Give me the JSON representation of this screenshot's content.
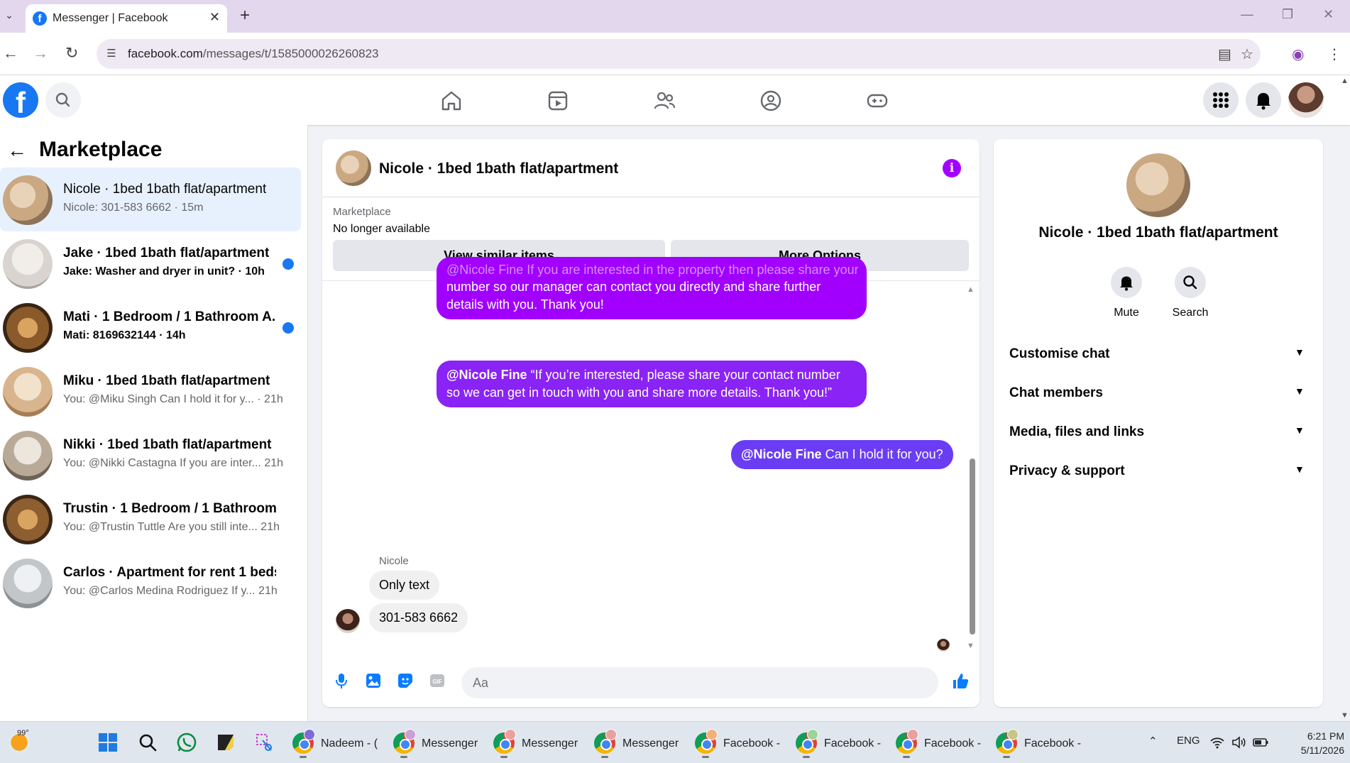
{
  "browser": {
    "tab_title": "Messenger | Facebook",
    "url_host": "facebook.com",
    "url_path": "/messages/t/1585000026260823"
  },
  "sidebar": {
    "title": "Marketplace",
    "conversations": [
      {
        "name": "Nicole · 1bed 1bath flat/apartment",
        "preview": "Nicole: 301-583 6662 · 15m",
        "unread": false,
        "active": true,
        "avatar_color": "#c9a882"
      },
      {
        "name": "Jake · 1bed 1bath flat/apartment",
        "preview": "Jake: Washer and dryer in unit? · 10h",
        "unread": true,
        "active": false,
        "avatar_color": "#d9d4cf"
      },
      {
        "name": "Mati · 1 Bedroom / 1 Bathroom A...",
        "preview": "Mati: 8169632144 · 14h",
        "unread": true,
        "active": false,
        "avatar_color": "#8a5a2b"
      },
      {
        "name": "Miku · 1bed 1bath flat/apartment",
        "preview": "You: @Miku Singh Can I hold it for y... · 21h",
        "unread": false,
        "active": false,
        "avatar_color": "#d8b58e"
      },
      {
        "name": "Nikki · 1bed 1bath flat/apartment",
        "preview": "You: @Nikki Castagna If you are inter... 21h",
        "unread": false,
        "active": false,
        "avatar_color": "#b9aa98"
      },
      {
        "name": "Trustin · 1 Bedroom / 1 Bathroom ...",
        "preview": "You: @Trustin Tuttle Are you still inte... 21h",
        "unread": false,
        "active": false,
        "avatar_color": "#8c5e30"
      },
      {
        "name": "Carlos · Apartment for rent 1 beds ...",
        "preview": "You: @Carlos Medina Rodriguez If y... 21h",
        "unread": false,
        "active": false,
        "avatar_color": "#c3c6c8"
      }
    ]
  },
  "chat": {
    "title": "Nicole · 1bed 1bath flat/apartment",
    "marketplace_label": "Marketplace",
    "listing_status": "No longer available",
    "btn_similar": "View similar items",
    "btn_more": "More Options",
    "messages": {
      "m1_text": "number so our manager can contact you directly and share further details with you. Thank you!",
      "m1_cut": "@Nicole Fine If you are interested in the property then please share your contact",
      "m2_mention": "@Nicole Fine",
      "m2_text": " “If you’re interested, please share your contact number so we can get in touch with you and share more details. Thank you!”",
      "m3_mention": "@Nicole Fine",
      "m3_text": " Can I hold it for you?",
      "sender": "Nicole",
      "in1": "Only text",
      "in2": "301-583 6662"
    },
    "composer_placeholder": "Aa"
  },
  "info_panel": {
    "title": "Nicole · 1bed 1bath flat/apartment",
    "mute_label": "Mute",
    "search_label": "Search",
    "rows": [
      "Customise chat",
      "Chat members",
      "Media, files and links",
      "Privacy & support"
    ]
  },
  "taskbar": {
    "temperature": "99°",
    "apps": [
      "Nadeem - (",
      "Messenger",
      "Messenger",
      "Messenger",
      "Facebook -",
      "Facebook -",
      "Facebook -",
      "Facebook -"
    ],
    "lang": "ENG",
    "time": "6:21 PM",
    "date": "5/11/2026"
  },
  "colors": {
    "fb_blue": "#1877f2",
    "bubble_purple_1": "#a100ff",
    "bubble_purple_2": "#8a23f5",
    "bubble_blue_purple": "#6a3cf4"
  }
}
